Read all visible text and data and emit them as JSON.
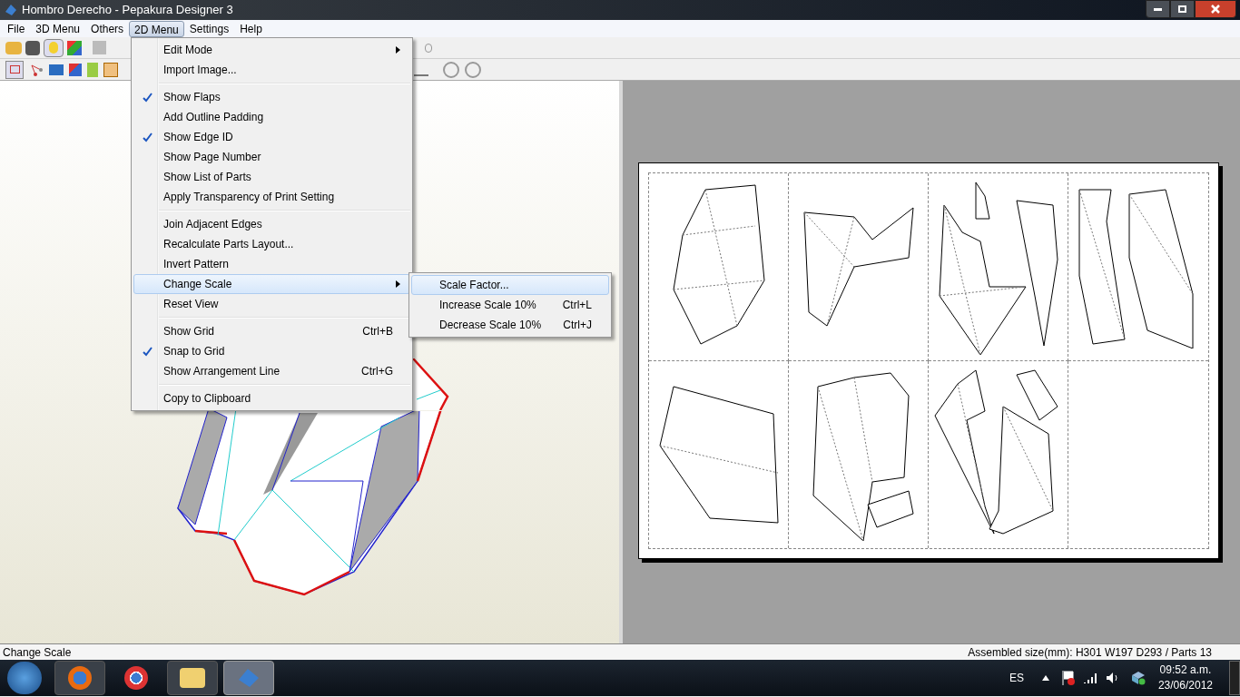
{
  "window": {
    "title": "Hombro Derecho - Pepakura Designer 3"
  },
  "menu_bar": [
    {
      "label": "File",
      "selected": false
    },
    {
      "label": "3D Menu",
      "selected": false
    },
    {
      "label": "Others",
      "selected": false
    },
    {
      "label": "2D Menu",
      "selected": true
    },
    {
      "label": "Settings",
      "selected": false
    },
    {
      "label": "Help",
      "selected": false
    }
  ],
  "menu": [
    {
      "kind": "item",
      "label": "Edit Mode",
      "submenu": true,
      "checked": false,
      "selected": false
    },
    {
      "kind": "item",
      "label": "Import Image...",
      "submenu": false,
      "checked": false,
      "selected": false
    },
    {
      "kind": "separator"
    },
    {
      "kind": "item",
      "label": "Show Flaps",
      "submenu": false,
      "checked": true,
      "selected": false
    },
    {
      "kind": "item",
      "label": "Add Outline Padding",
      "submenu": false,
      "checked": false,
      "selected": false
    },
    {
      "kind": "item",
      "label": "Show Edge ID",
      "submenu": false,
      "checked": true,
      "selected": false
    },
    {
      "kind": "item",
      "label": "Show Page Number",
      "submenu": false,
      "checked": false,
      "selected": false
    },
    {
      "kind": "item",
      "label": "Show List of Parts",
      "submenu": false,
      "checked": false,
      "selected": false
    },
    {
      "kind": "item",
      "label": "Apply Transparency of Print Setting",
      "submenu": false,
      "checked": false,
      "selected": false
    },
    {
      "kind": "separator"
    },
    {
      "kind": "item",
      "label": "Join Adjacent Edges",
      "submenu": false,
      "checked": false,
      "selected": false
    },
    {
      "kind": "item",
      "label": "Recalculate Parts Layout...",
      "submenu": false,
      "checked": false,
      "selected": false
    },
    {
      "kind": "item",
      "label": "Invert Pattern",
      "submenu": false,
      "checked": false,
      "selected": false
    },
    {
      "kind": "item",
      "label": "Change Scale",
      "submenu": true,
      "checked": false,
      "selected": true
    },
    {
      "kind": "item",
      "label": "Reset View",
      "submenu": false,
      "checked": false,
      "selected": false
    },
    {
      "kind": "separator"
    },
    {
      "kind": "item",
      "label": "Show Grid",
      "shortcut": "Ctrl+B",
      "submenu": false,
      "checked": false,
      "selected": false
    },
    {
      "kind": "item",
      "label": "Snap to Grid",
      "submenu": false,
      "checked": true,
      "selected": false
    },
    {
      "kind": "item",
      "label": "Show Arrangement Line",
      "shortcut": "Ctrl+G",
      "submenu": false,
      "checked": false,
      "selected": false
    },
    {
      "kind": "separator"
    },
    {
      "kind": "item",
      "label": "Copy to Clipboard",
      "submenu": false,
      "checked": false,
      "selected": false
    }
  ],
  "submenu": [
    {
      "label": "Scale Factor...",
      "selected": true
    },
    {
      "label": "Increase Scale 10%",
      "shortcut": "Ctrl+L",
      "selected": false
    },
    {
      "label": "Decrease Scale 10%",
      "shortcut": "Ctrl+J",
      "selected": false
    }
  ],
  "status_bar": {
    "left": "Change Scale",
    "right": "Assembled size(mm): H301 W197 D293 / Parts 13"
  },
  "taskbar": {
    "language": "ES",
    "time": "09:52 a.m.",
    "date": "23/06/2012"
  }
}
